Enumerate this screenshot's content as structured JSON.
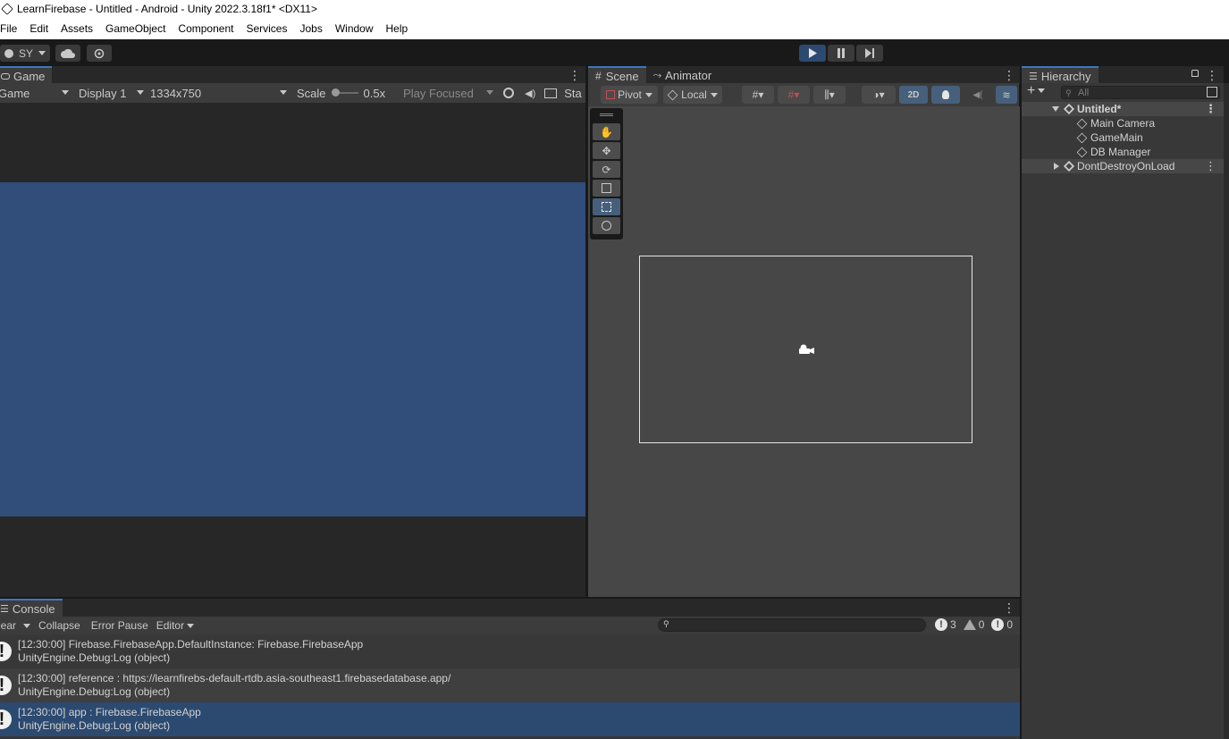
{
  "window": {
    "title": "LearnFirebase - Untitled - Android - Unity 2022.3.18f1* <DX11>"
  },
  "menu": [
    "File",
    "Edit",
    "Assets",
    "GameObject",
    "Component",
    "Services",
    "Jobs",
    "Window",
    "Help"
  ],
  "toolbar": {
    "account_label": "SY"
  },
  "game_panel": {
    "tab": "Game",
    "view_dropdown": "Game",
    "display": "Display 1",
    "resolution": "1334x750",
    "scale_label": "Scale",
    "scale_value": "0.5x",
    "play_mode": "Play Focused",
    "stats_label": "Sta"
  },
  "scene_panel": {
    "tabs": [
      "Scene",
      "Animator"
    ],
    "pivot": "Pivot",
    "local": "Local",
    "mode_2d": "2D"
  },
  "hierarchy": {
    "tab": "Hierarchy",
    "search_placeholder": "All",
    "scene_name": "Untitled*",
    "items": [
      "Main Camera",
      "GameMain",
      "DB Manager"
    ],
    "dont_destroy": "DontDestroyOnLoad"
  },
  "console": {
    "tab": "Console",
    "clear": "lear",
    "collapse": "Collapse",
    "error_pause": "Error Pause",
    "editor": "Editor",
    "count_info": "3",
    "count_warn": "0",
    "count_error": "0",
    "rows": [
      {
        "line1": "[12:30:00] Firebase.FirebaseApp.DefaultInstance: Firebase.FirebaseApp",
        "line2": "UnityEngine.Debug:Log (object)"
      },
      {
        "line1": "[12:30:00] reference : https://learnfirebs-default-rtdb.asia-southeast1.firebasedatabase.app/",
        "line2": "UnityEngine.Debug:Log (object)"
      },
      {
        "line1": "[12:30:00] app : Firebase.FirebaseApp",
        "line2": "UnityEngine.Debug:Log (object)"
      }
    ]
  },
  "colors": {
    "accent": "#2c4a70",
    "selection": "#2c4a70",
    "game_background": "#314d79"
  }
}
